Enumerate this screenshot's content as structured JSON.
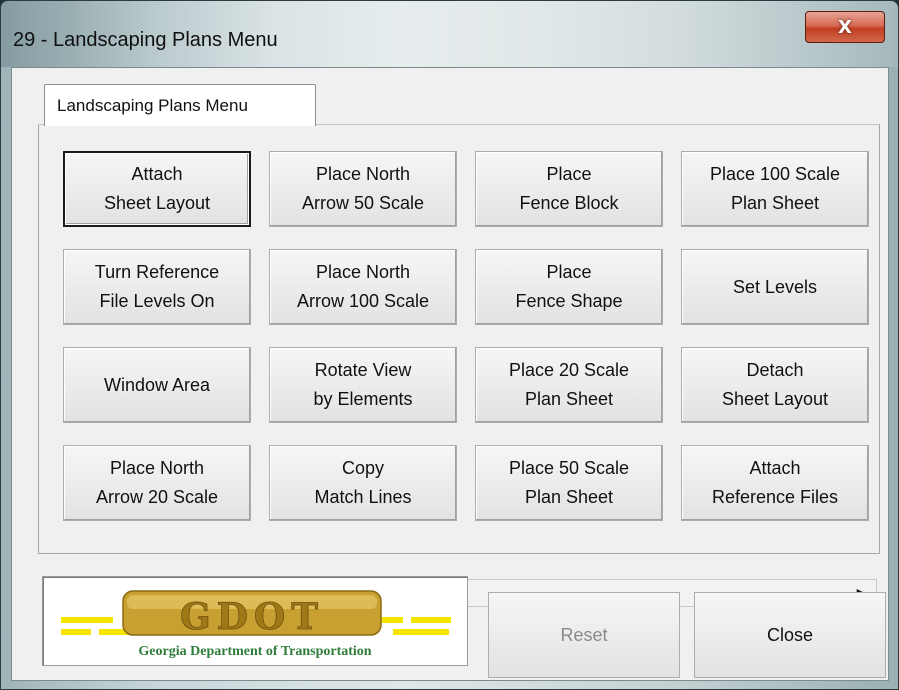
{
  "window": {
    "title": "29 - Landscaping Plans Menu",
    "close_glyph": "X"
  },
  "tabs": [
    {
      "label": "Landscaping Plans Menu",
      "selected": true
    }
  ],
  "buttons": [
    {
      "label": "Attach\nSheet Layout",
      "focused": true
    },
    {
      "label": "Place North\nArrow 50 Scale"
    },
    {
      "label": "Place\nFence Block"
    },
    {
      "label": "Place 100 Scale\nPlan Sheet"
    },
    {
      "label": "Turn Reference\nFile Levels On"
    },
    {
      "label": "Place North\nArrow 100 Scale"
    },
    {
      "label": "Place\nFence Shape"
    },
    {
      "label": "Set Levels"
    },
    {
      "label": "Window Area"
    },
    {
      "label": "Rotate View\nby Elements"
    },
    {
      "label": "Place 20 Scale\nPlan Sheet"
    },
    {
      "label": "Detach\nSheet Layout"
    },
    {
      "label": "Place North\nArrow 20 Scale"
    },
    {
      "label": "Copy\nMatch Lines"
    },
    {
      "label": "Place 50 Scale\nPlan Sheet"
    },
    {
      "label": "Attach\nReference Files"
    }
  ],
  "scrollbar": {
    "left_icon": "scroll-left-arrow-icon",
    "right_icon": "scroll-right-arrow-icon",
    "left_glyph": "◀",
    "right_glyph": "▶"
  },
  "logo": {
    "wordmark": "GDOT",
    "caption": "Georgia Department of Transportation",
    "gold": "#c8a032",
    "yellow": "#f5e600",
    "green": "#2e7d3a"
  },
  "actions": {
    "reset_label": "Reset",
    "reset_enabled": false,
    "close_label": "Close"
  }
}
